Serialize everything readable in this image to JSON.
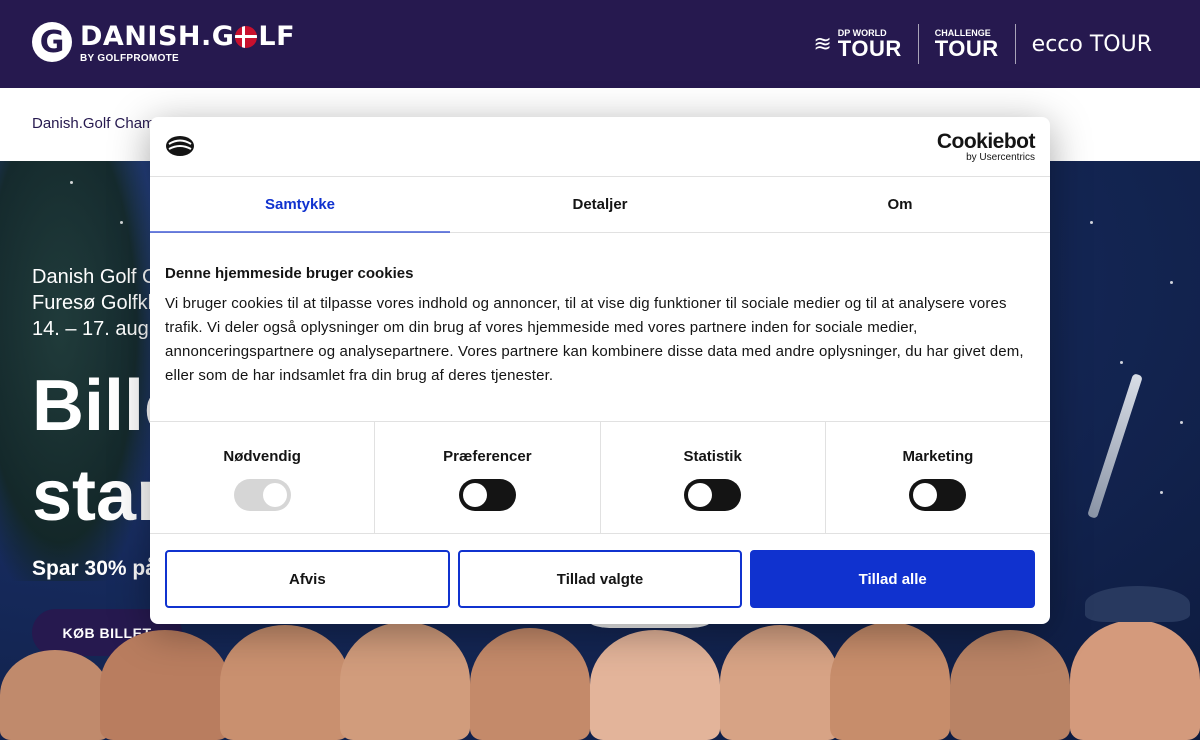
{
  "header": {
    "logo_letter": "G",
    "logo_text_left": "DANISH.G",
    "logo_text_right": "LF",
    "logo_sub": "BY GOLFPROMOTE",
    "tours": [
      {
        "small": "DP WORLD",
        "big": "TOUR"
      },
      {
        "small": "CHALLENGE",
        "big": "TOUR"
      },
      {
        "small": "",
        "big": "ecco TOUR"
      }
    ]
  },
  "breadcrumb": "Danish.Golf Cham",
  "hero": {
    "line1": "Danish Golf C",
    "line2": "Furesø Golfkl",
    "line3": "14. – 17. augu",
    "title1": "Bille",
    "title2": "star",
    "spar": "Spar 30% på",
    "cta": "KØB BILLET"
  },
  "cookie": {
    "brand": "Cookiebot",
    "brand_sub": "by Usercentrics",
    "tabs": [
      "Samtykke",
      "Detaljer",
      "Om"
    ],
    "heading": "Denne hjemmeside bruger cookies",
    "body": "Vi bruger cookies til at tilpasse vores indhold og annoncer, til at vise dig funktioner til sociale medier og til at analysere vores trafik. Vi deler også oplysninger om din brug af vores hjemmeside med vores partnere inden for sociale medier, annonceringspartnere og analysepartnere. Vores partnere kan kombinere disse data med andre oplysninger, du har givet dem, eller som de har indsamlet fra din brug af deres tjenester.",
    "toggles": [
      {
        "label": "Nødvendig",
        "on": true,
        "disabled": true
      },
      {
        "label": "Præferencer",
        "on": false,
        "disabled": false
      },
      {
        "label": "Statistik",
        "on": false,
        "disabled": false
      },
      {
        "label": "Marketing",
        "on": false,
        "disabled": false
      }
    ],
    "buttons": {
      "reject": "Afvis",
      "allow_selected": "Tillad valgte",
      "allow_all": "Tillad alle"
    },
    "accent_color": "#1032cf"
  },
  "colors": {
    "brand": "#26194f"
  }
}
